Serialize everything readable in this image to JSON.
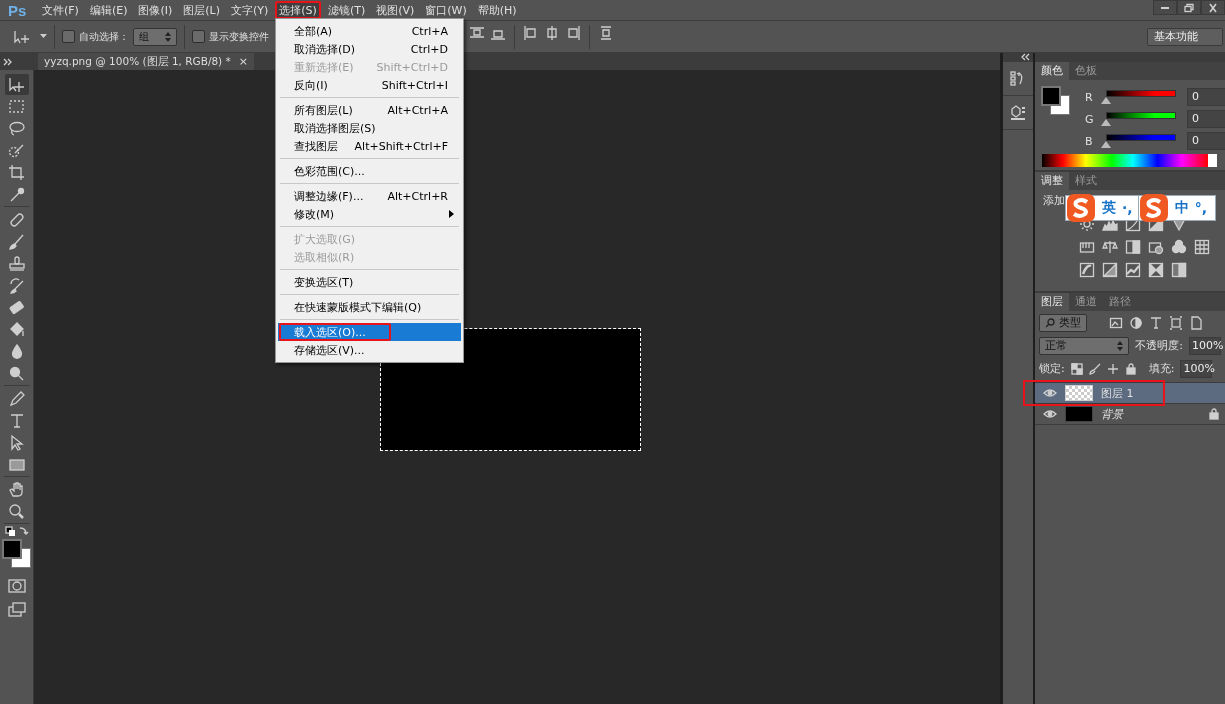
{
  "logo": "Ps",
  "menubar": [
    {
      "label": "文件(F)",
      "open": false,
      "annotated": false
    },
    {
      "label": "编辑(E)",
      "open": false,
      "annotated": false
    },
    {
      "label": "图像(I)",
      "open": false,
      "annotated": false
    },
    {
      "label": "图层(L)",
      "open": false,
      "annotated": false
    },
    {
      "label": "文字(Y)",
      "open": false,
      "annotated": false
    },
    {
      "label": "选择(S)",
      "open": true,
      "annotated": true
    },
    {
      "label": "滤镜(T)",
      "open": false,
      "annotated": false
    },
    {
      "label": "视图(V)",
      "open": false,
      "annotated": false
    },
    {
      "label": "窗口(W)",
      "open": false,
      "annotated": false
    },
    {
      "label": "帮助(H)",
      "open": false,
      "annotated": false
    }
  ],
  "options_bar": {
    "auto_select": {
      "label": "自动选择：",
      "checked": false
    },
    "auto_select_target": "组",
    "show_transform": {
      "label": "显示变换控件",
      "checked": false
    },
    "workspace": "基本功能"
  },
  "document_tab": {
    "title": "yyzq.png @ 100% (图层 1, RGB/8) *",
    "close": "×"
  },
  "select_menu": {
    "groups": [
      [
        {
          "label": "全部(A)",
          "shortcut": "Ctrl+A",
          "disabled": false,
          "selected": false,
          "annotated": false,
          "submenu": false
        },
        {
          "label": "取消选择(D)",
          "shortcut": "Ctrl+D",
          "disabled": false,
          "selected": false,
          "annotated": false,
          "submenu": false
        },
        {
          "label": "重新选择(E)",
          "shortcut": "Shift+Ctrl+D",
          "disabled": true,
          "selected": false,
          "annotated": false,
          "submenu": false
        },
        {
          "label": "反向(I)",
          "shortcut": "Shift+Ctrl+I",
          "disabled": false,
          "selected": false,
          "annotated": false,
          "submenu": false
        }
      ],
      [
        {
          "label": "所有图层(L)",
          "shortcut": "Alt+Ctrl+A",
          "disabled": false,
          "selected": false,
          "annotated": false,
          "submenu": false
        },
        {
          "label": "取消选择图层(S)",
          "disabled": false,
          "selected": false,
          "annotated": false,
          "submenu": false
        },
        {
          "label": "查找图层",
          "shortcut": "Alt+Shift+Ctrl+F",
          "disabled": false,
          "selected": false,
          "annotated": false,
          "submenu": false
        }
      ],
      [
        {
          "label": "色彩范围(C)...",
          "disabled": false,
          "selected": false,
          "annotated": false,
          "submenu": false
        }
      ],
      [
        {
          "label": "调整边缘(F)...",
          "shortcut": "Alt+Ctrl+R",
          "disabled": false,
          "selected": false,
          "annotated": false,
          "submenu": false
        },
        {
          "label": "修改(M)",
          "disabled": false,
          "selected": false,
          "annotated": false,
          "submenu": true
        }
      ],
      [
        {
          "label": "扩大选取(G)",
          "disabled": true,
          "selected": false,
          "annotated": false,
          "submenu": false
        },
        {
          "label": "选取相似(R)",
          "disabled": true,
          "selected": false,
          "annotated": false,
          "submenu": false
        }
      ],
      [
        {
          "label": "变换选区(T)",
          "disabled": false,
          "selected": false,
          "annotated": false,
          "submenu": false
        }
      ],
      [
        {
          "label": "在快速蒙版模式下编辑(Q)",
          "disabled": false,
          "selected": false,
          "annotated": false,
          "submenu": false
        }
      ],
      [
        {
          "label": "载入选区(O)...",
          "disabled": false,
          "selected": true,
          "annotated": true,
          "submenu": false
        },
        {
          "label": "存储选区(V)...",
          "disabled": false,
          "selected": false,
          "annotated": false,
          "submenu": false
        }
      ]
    ]
  },
  "color_panel": {
    "tabs": [
      {
        "label": "颜色",
        "selected": true
      },
      {
        "label": "色板",
        "selected": false
      }
    ],
    "channels": [
      {
        "name": "R",
        "color": "#ff0000",
        "level": 0,
        "value": "0"
      },
      {
        "name": "G",
        "color": "#00ff00",
        "level": 0,
        "value": "0"
      },
      {
        "name": "B",
        "color": "#0000ff",
        "level": 0,
        "value": "0"
      }
    ]
  },
  "adjustments_panel": {
    "tabs": [
      {
        "label": "调整",
        "selected": true
      },
      {
        "label": "样式",
        "selected": false
      }
    ],
    "label": "添加"
  },
  "ime_bar": {
    "segments": [
      {
        "mode": "英",
        "punctuation": "·,"
      },
      {
        "mode": "中",
        "punctuation": "°,"
      }
    ]
  },
  "layers_panel": {
    "tabs": [
      {
        "label": "图层",
        "selected": true
      },
      {
        "label": "通道",
        "selected": false
      },
      {
        "label": "路径",
        "selected": false
      }
    ],
    "filter": "类型",
    "blend_mode": "正常",
    "opacity_label": "不透明度:",
    "opacity": "100%",
    "lock_label": "锁定:",
    "fill_label": "填充:",
    "fill": "100%",
    "layers": [
      {
        "name": "图层 1",
        "kind": "layer",
        "transparent": true,
        "selected": true,
        "annotated": true,
        "locked": false
      },
      {
        "name": "背景",
        "kind": "background",
        "transparent": false,
        "selected": false,
        "annotated": false,
        "locked": true
      }
    ]
  }
}
